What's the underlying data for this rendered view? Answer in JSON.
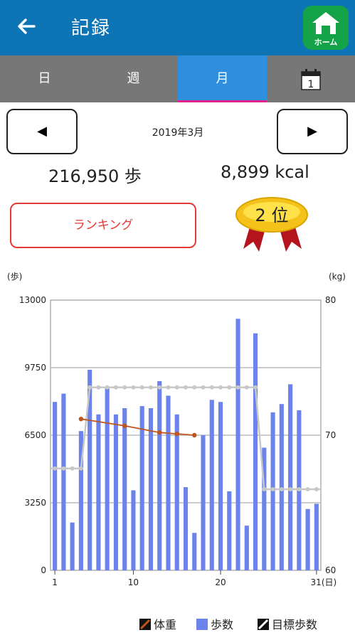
{
  "header": {
    "title": "記録",
    "home_label": "ホーム"
  },
  "tabs": [
    {
      "label": "日"
    },
    {
      "label": "週"
    },
    {
      "label": "月",
      "active": true
    }
  ],
  "calendar_icon_text": "1",
  "period": {
    "prev_glyph": "◀",
    "next_glyph": "▶",
    "label": "2019年3月"
  },
  "summary": {
    "steps": "216,950 歩",
    "kcal": "8,899 kcal"
  },
  "ranking": {
    "button_label": "ランキング",
    "rank_text": "2 位"
  },
  "colors": {
    "header": "#0d74b6",
    "tab_active": "#2f8fdf",
    "bar": "#6b83ea",
    "weight": "#c0541c",
    "goal": "#c8c8c8",
    "rank_red": "#e53935"
  },
  "chart_data": {
    "type": "bar",
    "left_unit": "(歩)",
    "right_unit": "(kg)",
    "left_ticks": [
      "13000",
      "9750",
      "6500",
      "3250",
      "0"
    ],
    "right_ticks": [
      "80",
      "70",
      "60"
    ],
    "x_ticks": [
      "1",
      "10",
      "20",
      "31(日)"
    ],
    "ylim_left": [
      0,
      13000
    ],
    "ylim_right": [
      60,
      80
    ],
    "days": [
      1,
      2,
      3,
      4,
      5,
      6,
      7,
      8,
      9,
      10,
      11,
      12,
      13,
      14,
      15,
      16,
      17,
      18,
      19,
      20,
      21,
      22,
      23,
      24,
      25,
      26,
      27,
      28,
      29,
      30,
      31
    ],
    "series": [
      {
        "name": "歩数",
        "values": [
          8100,
          8500,
          2300,
          6700,
          9650,
          7500,
          8800,
          7500,
          7800,
          3850,
          7900,
          7800,
          9100,
          8400,
          7500,
          4000,
          1800,
          6500,
          8200,
          8100,
          3800,
          12100,
          2150,
          11400,
          5900,
          7600,
          8000,
          8950,
          7700,
          2950,
          3200
        ]
      },
      {
        "name": "体重",
        "values": [
          null,
          null,
          null,
          null,
          null,
          null,
          null,
          null,
          null,
          null,
          null,
          null,
          null,
          null,
          null,
          null,
          null,
          null,
          null,
          null,
          null,
          null,
          null,
          null,
          null,
          null,
          null,
          null,
          null,
          null,
          null
        ]
      },
      {
        "name": "目標歩数",
        "values": [
          4900,
          4900,
          4900,
          4900,
          8800,
          8800,
          8800,
          8800,
          8800,
          8800,
          8800,
          8800,
          8800,
          8800,
          8800,
          8800,
          8800,
          8800,
          8800,
          8800,
          8800,
          8800,
          8800,
          8800,
          3900,
          3900,
          3900,
          3900,
          3900,
          3900,
          3900
        ]
      }
    ],
    "weight_points": [
      {
        "day": 4,
        "kg": 71.2
      },
      {
        "day": 9,
        "kg": 70.7
      },
      {
        "day": 13,
        "kg": 70.2
      },
      {
        "day": 15,
        "kg": 70.1
      },
      {
        "day": 17,
        "kg": 70.0
      }
    ],
    "grid": true,
    "legend": [
      "体重",
      "歩数",
      "目標歩数"
    ]
  }
}
